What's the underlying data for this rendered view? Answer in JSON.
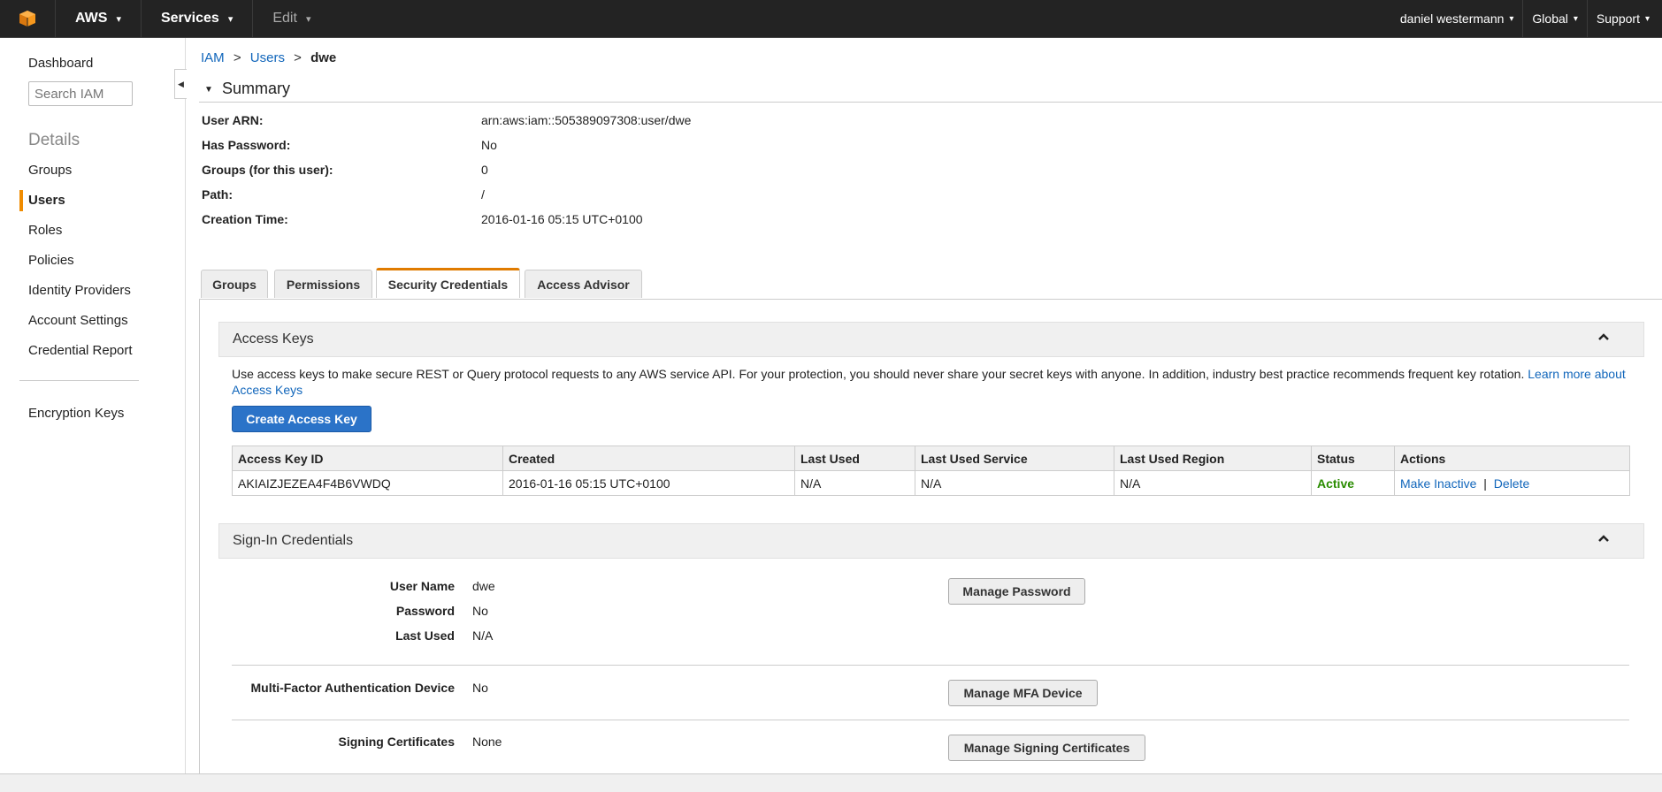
{
  "topbar": {
    "brand": "AWS",
    "services": "Services",
    "edit": "Edit",
    "user": "daniel westermann",
    "region": "Global",
    "support": "Support",
    "colors": {
      "bg": "#232323",
      "logo": "#f7981d"
    }
  },
  "sidebar": {
    "dashboard": "Dashboard",
    "search_placeholder": "Search IAM",
    "details_heading": "Details",
    "items": [
      "Groups",
      "Users",
      "Roles",
      "Policies",
      "Identity Providers",
      "Account Settings",
      "Credential Report"
    ],
    "active_item": "Users",
    "extra": "Encryption Keys"
  },
  "breadcrumb": {
    "root": "IAM",
    "section": "Users",
    "current": "dwe",
    "sep": ">"
  },
  "summary": {
    "title": "Summary",
    "rows": [
      {
        "label": "User ARN:",
        "value": "arn:aws:iam::505389097308:user/dwe"
      },
      {
        "label": "Has Password:",
        "value": "No"
      },
      {
        "label": "Groups (for this user):",
        "value": "0"
      },
      {
        "label": "Path:",
        "value": "/"
      },
      {
        "label": "Creation Time:",
        "value": "2016-01-16 05:15 UTC+0100"
      }
    ]
  },
  "tabs": [
    "Groups",
    "Permissions",
    "Security Credentials",
    "Access Advisor"
  ],
  "active_tab": "Security Credentials",
  "access_keys": {
    "title": "Access Keys",
    "description": "Use access keys to make secure REST or Query protocol requests to any AWS service API. For your protection, you should never share your secret keys with anyone. In addition, industry best practice recommends frequent key rotation.",
    "learn_more": "Learn more about Access Keys",
    "create_button": "Create Access Key",
    "columns": [
      "Access Key ID",
      "Created",
      "Last Used",
      "Last Used Service",
      "Last Used Region",
      "Status",
      "Actions"
    ],
    "row": {
      "id": "AKIAIZJEZEA4F4B6VWDQ",
      "created": "2016-01-16 05:15 UTC+0100",
      "last_used": "N/A",
      "last_used_service": "N/A",
      "last_used_region": "N/A",
      "status": "Active",
      "action_inactive": "Make Inactive",
      "action_sep": "|",
      "action_delete": "Delete"
    }
  },
  "signin": {
    "title": "Sign-In Credentials",
    "user_name_label": "User Name",
    "user_name": "dwe",
    "password_label": "Password",
    "password": "No",
    "last_used_label": "Last Used",
    "last_used": "N/A",
    "manage_password": "Manage Password",
    "mfa_label": "Multi-Factor Authentication Device",
    "mfa": "No",
    "manage_mfa": "Manage MFA Device",
    "signing_label": "Signing Certificates",
    "signing": "None",
    "manage_signing": "Manage Signing Certificates"
  }
}
